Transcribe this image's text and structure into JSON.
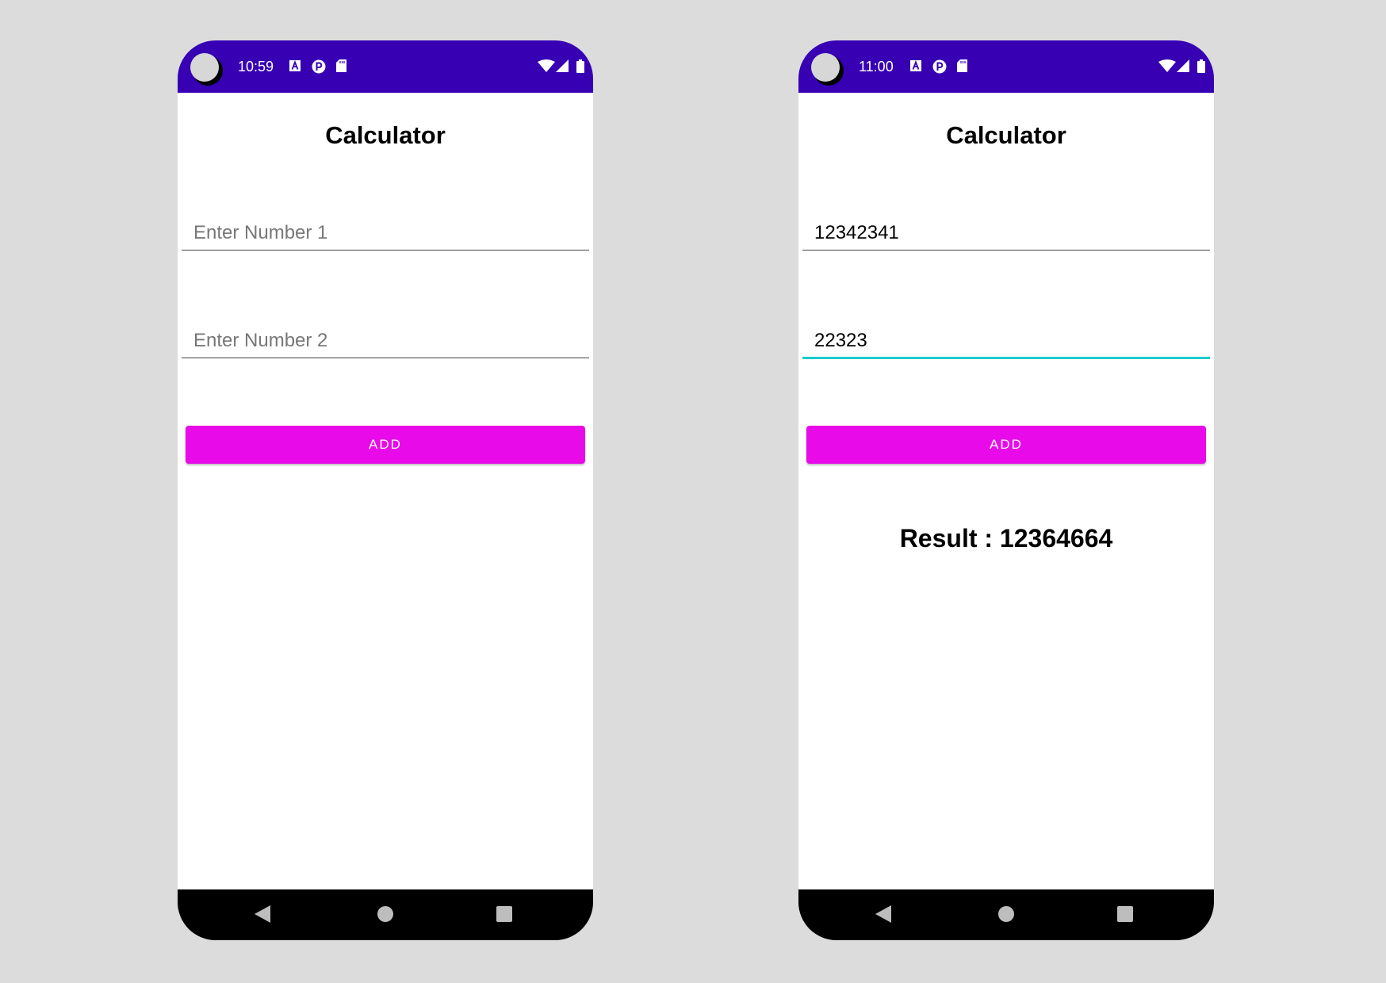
{
  "screens": [
    {
      "status_bar": {
        "time": "10:59"
      },
      "title": "Calculator",
      "number1": {
        "value": "",
        "placeholder": "Enter Number 1"
      },
      "number2": {
        "value": "",
        "placeholder": "Enter Number 2"
      },
      "add_button_label": "ADD",
      "result_text": ""
    },
    {
      "status_bar": {
        "time": "11:00"
      },
      "title": "Calculator",
      "number1": {
        "value": "12342341",
        "placeholder": "Enter Number 1"
      },
      "number2": {
        "value": "22323",
        "placeholder": "Enter Number 2"
      },
      "add_button_label": "ADD",
      "result_text": "Result : 12364664"
    }
  ],
  "status_icons": [
    "a-letter-icon",
    "p-circle-icon",
    "sd-card-icon",
    "wifi-icon",
    "cell-signal-icon",
    "battery-icon"
  ],
  "nav_icons": [
    "back-icon",
    "home-icon",
    "recents-icon"
  ],
  "colors": {
    "status_bar": "#3700b3",
    "add_button": "#e80ae8",
    "focused_underline": "#1ccbcb",
    "background": "#dcdcdc"
  }
}
